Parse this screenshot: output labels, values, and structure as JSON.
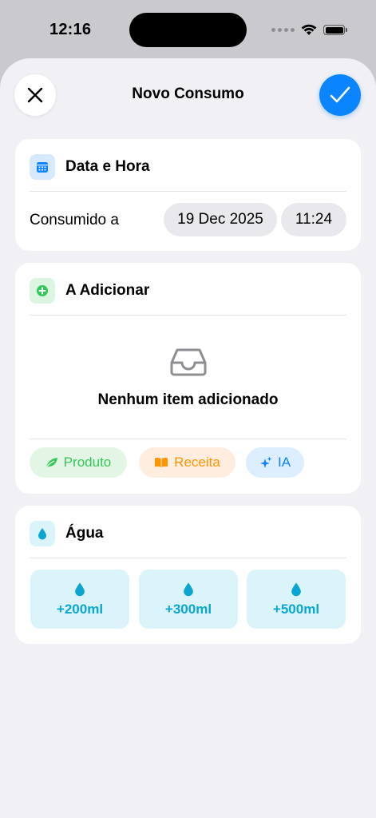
{
  "status_bar": {
    "time": "12:16"
  },
  "sheet": {
    "title": "Novo Consumo"
  },
  "date_section": {
    "title": "Data e Hora",
    "label": "Consumido a",
    "date": "19 Dec 2025",
    "time": "11:24"
  },
  "add_section": {
    "title": "A Adicionar",
    "empty_message": "Nenhum item adicionado",
    "chips": [
      {
        "label": "Produto",
        "icon": "leaf-icon",
        "color": "#34c759"
      },
      {
        "label": "Receita",
        "icon": "book-icon",
        "color": "#ff9500"
      },
      {
        "label": "IA",
        "icon": "sparkles-icon",
        "color": "#0a84ff"
      }
    ]
  },
  "water_section": {
    "title": "Água",
    "buttons": [
      {
        "label": "+200ml"
      },
      {
        "label": "+300ml"
      },
      {
        "label": "+500ml"
      }
    ]
  },
  "colors": {
    "accent": "#0a84ff",
    "water": "#0aa6d1",
    "green": "#34c759",
    "orange": "#ff9500"
  }
}
